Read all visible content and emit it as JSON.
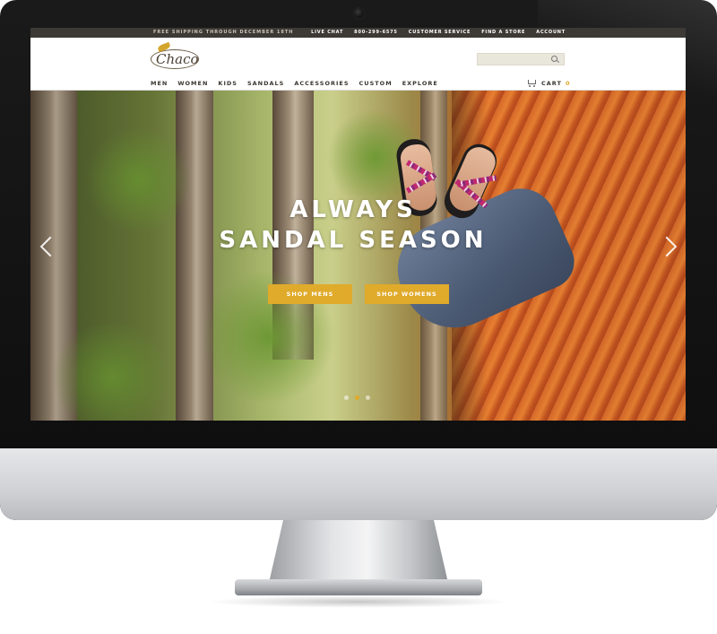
{
  "promo": {
    "text": "FREE SHIPPING THROUGH DECEMBER 18TH"
  },
  "utility_nav": {
    "live_chat": "LIVE CHAT",
    "phone": "800-299-6575",
    "customer_service": "CUSTOMER SERVICE",
    "find_store": "FIND A STORE",
    "account": "ACCOUNT"
  },
  "logo": {
    "text": "Chaco"
  },
  "search": {
    "placeholder": ""
  },
  "main_nav": [
    {
      "label": "MEN"
    },
    {
      "label": "WOMEN"
    },
    {
      "label": "KIDS"
    },
    {
      "label": "SANDALS"
    },
    {
      "label": "ACCESSORIES"
    },
    {
      "label": "CUSTOM"
    },
    {
      "label": "EXPLORE"
    }
  ],
  "cart": {
    "label": "CART",
    "count": "0"
  },
  "hero": {
    "headline_line1": "ALWAYS",
    "headline_line2": "SANDAL SEASON",
    "cta_mens": "SHOP MENS",
    "cta_womens": "SHOP WOMENS",
    "slide_count": 3,
    "active_slide": 1
  },
  "colors": {
    "accent": "#e0aa2b",
    "promo_bar": "#3d3a36",
    "nav_text": "#3a3530"
  }
}
